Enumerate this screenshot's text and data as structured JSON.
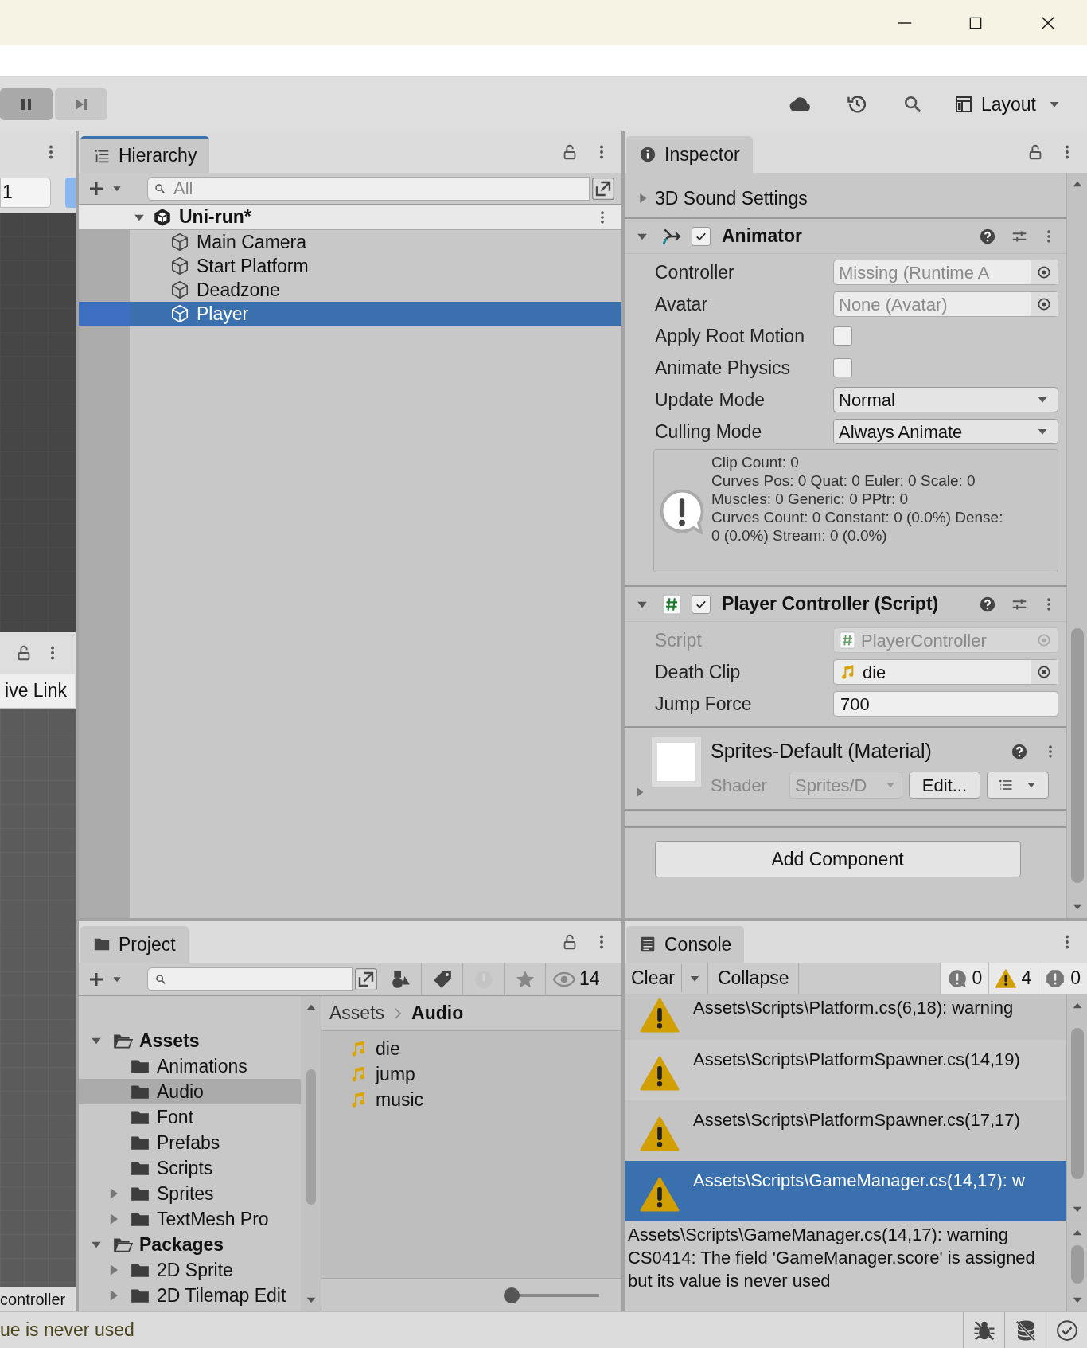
{
  "toolbar": {
    "layout_button": "Layout"
  },
  "scene_strip": {
    "field_value": "1",
    "live_link_button": "ive Link",
    "footer_label": "controller"
  },
  "hierarchy": {
    "title": "Hierarchy",
    "search_placeholder": "All",
    "scene": {
      "name": "Uni-run*",
      "expanded": true,
      "children": [
        {
          "name": "Main Camera",
          "selected": false
        },
        {
          "name": "Start Platform",
          "selected": false
        },
        {
          "name": "Deadzone",
          "selected": false
        },
        {
          "name": "Player",
          "selected": true
        }
      ]
    }
  },
  "inspector": {
    "title": "Inspector",
    "components": [
      {
        "kind": "foldout",
        "title": "3D Sound Settings",
        "expanded": false
      },
      {
        "kind": "animator",
        "title": "Animator",
        "enabled": true,
        "expanded": true,
        "fields": [
          {
            "kind": "asset",
            "label": "Controller",
            "value": "Missing (Runtime A",
            "disabled": false
          },
          {
            "kind": "asset",
            "label": "Avatar",
            "value": "None (Avatar)",
            "disabled": false
          },
          {
            "kind": "checkbox",
            "label": "Apply Root Motion",
            "checked": false,
            "disabled": false
          },
          {
            "kind": "checkbox",
            "label": "Animate Physics",
            "checked": false,
            "disabled": false
          },
          {
            "kind": "dropdown",
            "label": "Update Mode",
            "value": "Normal",
            "disabled": false
          },
          {
            "kind": "dropdown",
            "label": "Culling Mode",
            "value": "Always Animate",
            "disabled": false
          }
        ],
        "info": [
          "Clip Count: 0",
          "Curves Pos: 0 Quat: 0 Euler: 0 Scale: 0",
          "Muscles: 0 Generic: 0 PPtr: 0",
          "Curves Count: 0 Constant: 0 (0.0%) Dense:",
          "0 (0.0%) Stream: 0 (0.0%)"
        ]
      },
      {
        "kind": "script",
        "title": "Player Controller (Script)",
        "enabled": true,
        "expanded": true,
        "fields": [
          {
            "kind": "script",
            "label": "Script",
            "value": "PlayerController",
            "disabled": true
          },
          {
            "kind": "audio",
            "label": "Death Clip",
            "value": "die",
            "disabled": false
          },
          {
            "kind": "number",
            "label": "Jump Force",
            "value": "700",
            "disabled": false
          }
        ]
      },
      {
        "kind": "material",
        "title": "Sprites-Default (Material)",
        "expanded": false,
        "shader_label": "Shader",
        "shader_value": "Sprites/D",
        "edit_button": "Edit..."
      }
    ],
    "add_component_button": "Add Component"
  },
  "project": {
    "title": "Project",
    "filter_count": "14",
    "tree": [
      {
        "name": "Assets",
        "expanded": true,
        "selected": false,
        "children": [
          {
            "name": "Animations",
            "selected": false
          },
          {
            "name": "Audio",
            "selected": true
          },
          {
            "name": "Font",
            "selected": false
          },
          {
            "name": "Prefabs",
            "selected": false
          },
          {
            "name": "Scripts",
            "selected": false
          },
          {
            "name": "Sprites",
            "expanded": false,
            "selected": false
          },
          {
            "name": "TextMesh Pro",
            "expanded": false,
            "selected": false
          }
        ]
      },
      {
        "name": "Packages",
        "expanded": true,
        "selected": false,
        "children": [
          {
            "name": "2D Sprite",
            "expanded": false,
            "selected": false
          },
          {
            "name": "2D Tilemap Edit",
            "expanded": false,
            "selected": false
          }
        ]
      }
    ],
    "breadcrumb": [
      "Assets",
      "Audio"
    ],
    "files": [
      "die",
      "jump",
      "music"
    ],
    "zoom": {
      "level": 0
    }
  },
  "console": {
    "title": "Console",
    "clear_button": "Clear",
    "collapse_button": "Collapse",
    "counts": [
      {
        "kind": "info",
        "count": "0"
      },
      {
        "kind": "warning",
        "count": "4"
      },
      {
        "kind": "error",
        "count": "0"
      }
    ],
    "entries": [
      {
        "text": "Assets\\Scripts\\Platform.cs(6,18): warning",
        "selected": false
      },
      {
        "text": "Assets\\Scripts\\PlatformSpawner.cs(14,19)",
        "selected": false
      },
      {
        "text": "Assets\\Scripts\\PlatformSpawner.cs(17,17)",
        "selected": false
      },
      {
        "text": "Assets\\Scripts\\GameManager.cs(14,17): w",
        "selected": true
      }
    ],
    "detail": "Assets\\Scripts\\GameManager.cs(14,17): warning CS0414: The field 'GameManager.score' is assigned but its value is never used"
  },
  "status_bar": {
    "message": "ue is never used"
  }
}
